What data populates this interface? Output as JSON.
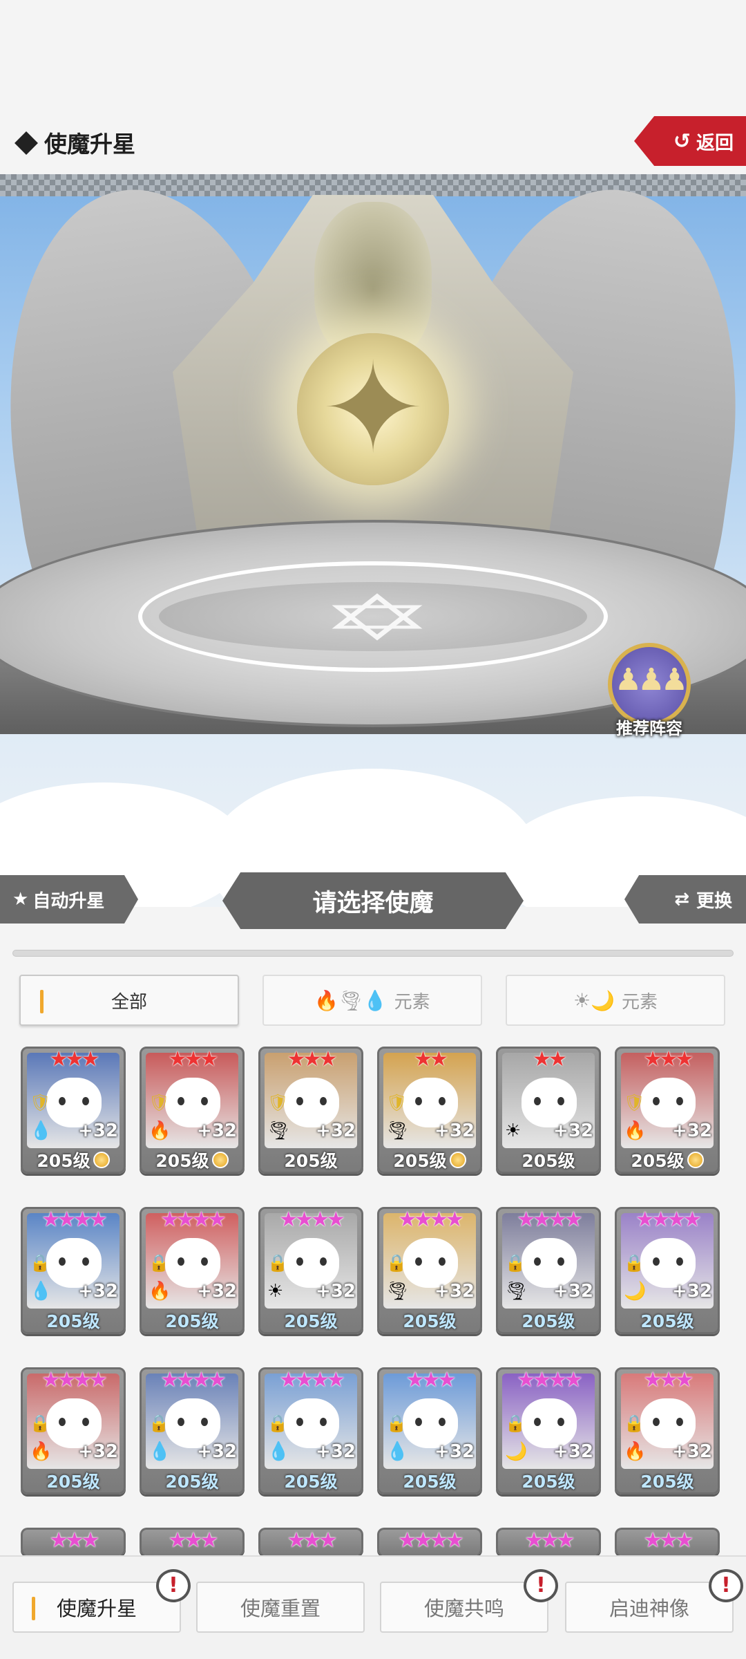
{
  "header": {
    "title": "使魔升星",
    "back_label": "返回"
  },
  "scene": {
    "recommend_label": "推荐阵容"
  },
  "band": {
    "auto_label": "自动升星",
    "select_label": "请选择使魔",
    "swap_label": "更换"
  },
  "filters": [
    {
      "label": "全部",
      "active": true
    },
    {
      "label": "元素",
      "icons": "🔥🌪💧",
      "active": false
    },
    {
      "label": "元素",
      "icons": "☀🌙",
      "active": false
    }
  ],
  "cards_row1": [
    {
      "stars": "★★★",
      "star_color": "#e33",
      "badge": "shield",
      "element": "💧",
      "element_name": "water",
      "plus": "+32",
      "level": "205级",
      "coin": true,
      "bg": "#5a78b8"
    },
    {
      "stars": "★★★",
      "star_color": "#e33",
      "badge": "shield",
      "element": "🔥",
      "element_name": "fire",
      "plus": "+32",
      "level": "205级",
      "coin": true,
      "bg": "#c85a5a"
    },
    {
      "stars": "★★★",
      "star_color": "#e33",
      "badge": "shield",
      "element": "🌪",
      "element_name": "wind",
      "plus": "+32",
      "level": "205级",
      "coin": false,
      "bg": "#c9a070"
    },
    {
      "stars": "★★",
      "star_color": "#e33",
      "badge": "shield",
      "element": "🌪",
      "element_name": "wind",
      "plus": "+32",
      "level": "205级",
      "coin": true,
      "bg": "#d4a350"
    },
    {
      "stars": "★★",
      "star_color": "#e33",
      "badge": "none",
      "element": "☀",
      "element_name": "light",
      "plus": "+32",
      "level": "205级",
      "coin": false,
      "bg": "#a7a7a7"
    },
    {
      "stars": "★★★",
      "star_color": "#e33",
      "badge": "shield",
      "element": "🔥",
      "element_name": "fire",
      "plus": "+32",
      "level": "205级",
      "coin": true,
      "bg": "#c46060"
    }
  ],
  "cards_row2": [
    {
      "stars": "★★★★",
      "star_color": "#e84fd1",
      "badge": "lock",
      "element": "💧",
      "element_name": "water",
      "plus": "+32",
      "level": "205级",
      "bg": "#5a85c6"
    },
    {
      "stars": "★★★★",
      "star_color": "#e84fd1",
      "badge": "lock",
      "element": "🔥",
      "element_name": "fire",
      "plus": "+32",
      "level": "205级",
      "bg": "#d06060"
    },
    {
      "stars": "★★★★",
      "star_color": "#e84fd1",
      "badge": "lock",
      "element": "☀",
      "element_name": "light",
      "plus": "+32",
      "level": "205级",
      "bg": "#a9a9a9"
    },
    {
      "stars": "★★★★",
      "star_color": "#e84fd1",
      "badge": "lock",
      "element": "🌪",
      "element_name": "wind",
      "plus": "+32",
      "level": "205级",
      "bg": "#dcb56c"
    },
    {
      "stars": "★★★★",
      "star_color": "#e84fd1",
      "badge": "lock",
      "element": "🌪",
      "element_name": "wind",
      "plus": "+32",
      "level": "205级",
      "bg": "#7e7e9c"
    },
    {
      "stars": "★★★★",
      "star_color": "#e84fd1",
      "badge": "lock",
      "element": "🌙",
      "element_name": "dark",
      "plus": "+32",
      "level": "205级",
      "bg": "#9a82c8"
    }
  ],
  "cards_row3": [
    {
      "stars": "★★★★",
      "star_color": "#e84fd1",
      "badge": "lock",
      "element": "🔥",
      "element_name": "fire",
      "plus": "+32",
      "level": "205级",
      "bg": "#c96a6a"
    },
    {
      "stars": "★★★★",
      "star_color": "#e84fd1",
      "badge": "lock",
      "element": "💧",
      "element_name": "water",
      "plus": "+32",
      "level": "205级",
      "bg": "#6a82b8"
    },
    {
      "stars": "★★★★",
      "star_color": "#e84fd1",
      "badge": "lock",
      "element": "💧",
      "element_name": "water",
      "plus": "+32",
      "level": "205级",
      "bg": "#7aa0d4"
    },
    {
      "stars": "★★★",
      "star_color": "#e84fd1",
      "badge": "lock",
      "element": "💧",
      "element_name": "water",
      "plus": "+32",
      "level": "205级",
      "bg": "#6d9bd8"
    },
    {
      "stars": "★★★★",
      "star_color": "#e84fd1",
      "badge": "lock",
      "element": "🌙",
      "element_name": "dark",
      "plus": "+32",
      "level": "205级",
      "bg": "#8a62c4"
    },
    {
      "stars": "★★★",
      "star_color": "#e84fd1",
      "badge": "lock",
      "element": "🔥",
      "element_name": "fire",
      "plus": "+32",
      "level": "205级",
      "bg": "#d87a7a"
    }
  ],
  "cards_row4_partial": [
    {
      "stars": "★★★",
      "star_color": "#e84fd1"
    },
    {
      "stars": "★★★",
      "star_color": "#e84fd1"
    },
    {
      "stars": "★★★",
      "star_color": "#e84fd1"
    },
    {
      "stars": "★★★★",
      "star_color": "#e84fd1"
    },
    {
      "stars": "★★★",
      "star_color": "#e84fd1"
    },
    {
      "stars": "★★★",
      "star_color": "#e84fd1"
    }
  ],
  "tabs": [
    {
      "label": "使魔升星",
      "active": true,
      "alert": true
    },
    {
      "label": "使魔重置",
      "active": false,
      "alert": false
    },
    {
      "label": "使魔共鸣",
      "active": false,
      "alert": true
    },
    {
      "label": "启迪神像",
      "active": false,
      "alert": true
    }
  ],
  "colors": {
    "accent_red": "#c7202c",
    "active_bar": "#f0a82d",
    "banner_gray": "#666666"
  }
}
